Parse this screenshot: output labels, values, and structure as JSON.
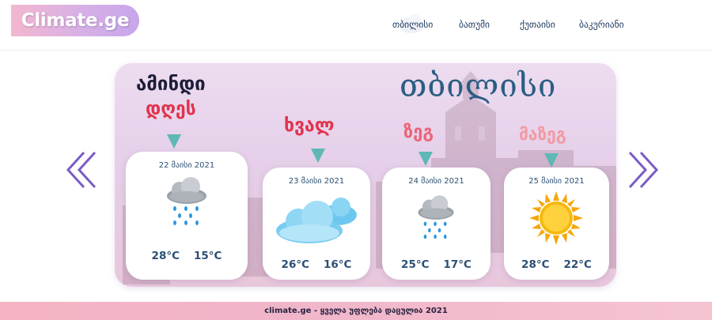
{
  "header": {
    "logo": "Climate.ge",
    "nav": [
      {
        "label": "თბილისი",
        "active": true
      },
      {
        "label": "ბათუმი",
        "active": false
      },
      {
        "label": "ქუთაისი",
        "active": false
      },
      {
        "label": "ბაკურიანი",
        "active": false
      }
    ]
  },
  "main": {
    "city": "თბილისი",
    "headings": {
      "today_line1": "ამინდი",
      "today_line2": "დღეს",
      "tomorrow": "ხვალ",
      "day_after": "ზეგ",
      "later": "მაზეგ"
    },
    "forecast": [
      {
        "date": "22 მაისი 2021",
        "high": "28°C",
        "low": "15°C",
        "icon": "rain-cloud-icon"
      },
      {
        "date": "23 მაისი 2021",
        "high": "26°C",
        "low": "16°C",
        "icon": "cloudy-icon"
      },
      {
        "date": "24 მაისი 2021",
        "high": "25°C",
        "low": "17°C",
        "icon": "rain-cloud-icon"
      },
      {
        "date": "25 მაისი 2021",
        "high": "28°C",
        "low": "22°C",
        "icon": "sun-icon"
      }
    ],
    "colors": {
      "accent": "#5fb8b5",
      "arrow": "#7b5cc4",
      "title": "#2b5d83",
      "heading_red": "#e0334c"
    }
  },
  "footer": {
    "text": "climate.ge - ყველა უფლება დაცულია 2021"
  }
}
